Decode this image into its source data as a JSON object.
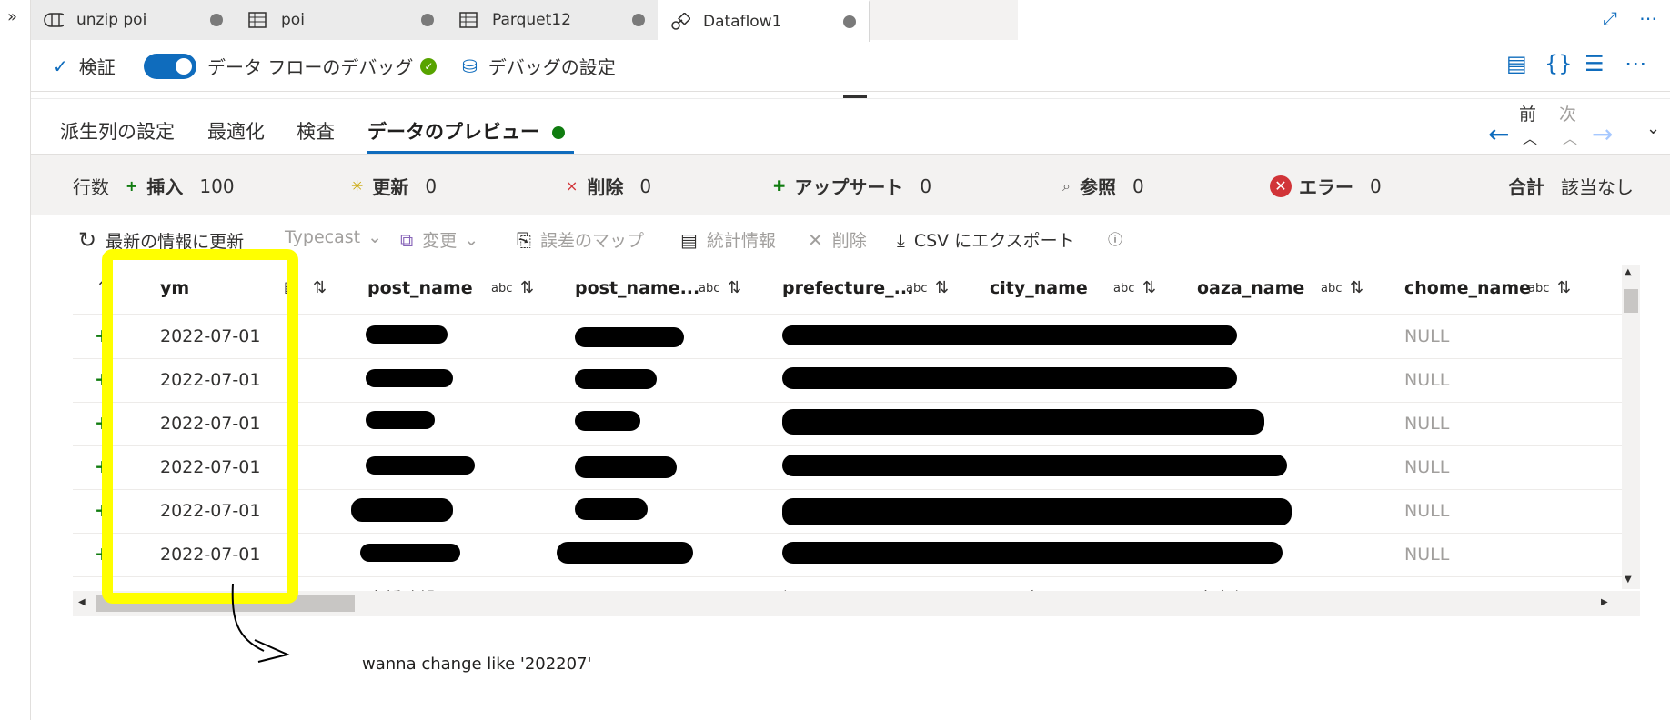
{
  "tabs": [
    {
      "label": "unzip poi",
      "icon": "pipeline-icon"
    },
    {
      "label": "poi",
      "icon": "table-icon"
    },
    {
      "label": "Parquet12",
      "icon": "table-icon"
    },
    {
      "label": "Dataflow1",
      "icon": "dataflow-icon",
      "active": true
    }
  ],
  "cmdbar": {
    "validate": "検証",
    "debug": "データ フローのデバッグ",
    "debug_settings": "デバッグの設定"
  },
  "subtabs": [
    "派生列の設定",
    "最適化",
    "検査",
    "データのプレビュー"
  ],
  "nav": {
    "prev": "前",
    "next": "次"
  },
  "stats": {
    "rows_label": "行数",
    "insert_label": "挿入",
    "insert_value": "100",
    "update_label": "更新",
    "update_value": "0",
    "delete_label": "削除",
    "delete_value": "0",
    "upsert_label": "アップサート",
    "upsert_value": "0",
    "lookup_label": "参照",
    "lookup_value": "0",
    "error_label": "エラー",
    "error_value": "0",
    "total_label": "合計",
    "total_value": "該当なし"
  },
  "toolbar": {
    "refresh": "最新の情報に更新",
    "typecast": "Typecast",
    "modify": "変更",
    "map_drifted": "誤差のマップ",
    "statistics": "統計情報",
    "remove": "削除",
    "export_csv": "CSV にエクスポート"
  },
  "columns": [
    "ym",
    "post_name",
    "post_name...",
    "prefecture_...",
    "city_name",
    "oaza_name",
    "chome_name"
  ],
  "type_label": "abc",
  "rows": [
    {
      "ym": "2022-07-01",
      "chome_name": "NULL"
    },
    {
      "ym": "2022-07-01",
      "chome_name": "NULL"
    },
    {
      "ym": "2022-07-01",
      "chome_name": "NULL"
    },
    {
      "ym": "2022-07-01",
      "chome_name": "NULL"
    },
    {
      "ym": "2022-07-01",
      "chome_name": "NULL"
    },
    {
      "ym": "2022-07-01",
      "chome_name": "NULL"
    }
  ],
  "partial_row": [
    "中橋建設",
    "ナチリシン",
    "福岡県",
    "田川市",
    "大字伊田"
  ],
  "annotation": "wanna change like '202207'",
  "colors": {
    "accent": "#0f6cbd",
    "success": "#107c10",
    "error": "#d13438",
    "highlight": "#ffff00"
  }
}
